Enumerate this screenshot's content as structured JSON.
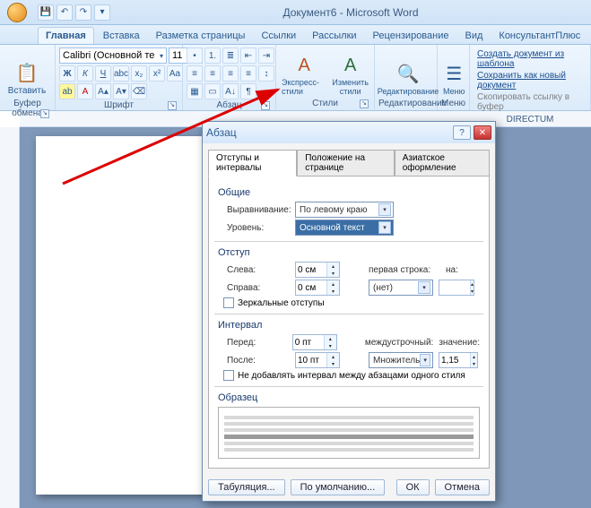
{
  "window": {
    "title": "Документ6 - Microsoft Word"
  },
  "tabs": {
    "home": "Главная",
    "insert": "Вставка",
    "layout": "Разметка страницы",
    "refs": "Ссылки",
    "mail": "Рассылки",
    "review": "Рецензирование",
    "view": "Вид",
    "consultant": "КонсультантПлюс"
  },
  "ribbon": {
    "clipboard": {
      "paste": "Вставить",
      "label": "Буфер обмена"
    },
    "font": {
      "name": "Calibri (Основной те",
      "size": "11",
      "label": "Шрифт"
    },
    "paragraph": {
      "label": "Абзац"
    },
    "styles": {
      "express": "Экспресс-стили",
      "change": "Изменить\nстили",
      "label": "Стили"
    },
    "editing": {
      "label": "Редактирование",
      "btn": "Редактирование"
    },
    "menu": {
      "label": "Меню",
      "btn": "Меню"
    },
    "directum": {
      "label": "DIRECTUM",
      "link1": "Создать документ из шаблона",
      "link2": "Сохранить как новый документ",
      "link3": "Скопировать ссылку в буфер"
    }
  },
  "dialog": {
    "title": "Абзац",
    "tabs": {
      "t1": "Отступы и интервалы",
      "t2": "Положение на странице",
      "t3": "Азиатское оформление"
    },
    "general": {
      "label": "Общие",
      "align_label": "Выравнивание:",
      "align_value": "По левому краю",
      "level_label": "Уровень:",
      "level_value": "Основной текст"
    },
    "indent": {
      "label": "Отступ",
      "left_label": "Слева:",
      "left_value": "0 см",
      "right_label": "Справа:",
      "right_value": "0 см",
      "first_label": "первая строка:",
      "first_value": "(нет)",
      "on_label": "на:",
      "on_value": "",
      "mirror": "Зеркальные отступы"
    },
    "spacing": {
      "label": "Интервал",
      "before_label": "Перед:",
      "before_value": "0 пт",
      "after_label": "После:",
      "after_value": "10 пт",
      "line_label": "междустрочный:",
      "line_value": "Множитель",
      "at_label": "значение:",
      "at_value": "1,15",
      "nodup": "Не добавлять интервал между абзацами одного стиля"
    },
    "preview": "Образец",
    "buttons": {
      "tabs": "Табуляция...",
      "default": "По умолчанию...",
      "ok": "ОК",
      "cancel": "Отмена"
    }
  }
}
